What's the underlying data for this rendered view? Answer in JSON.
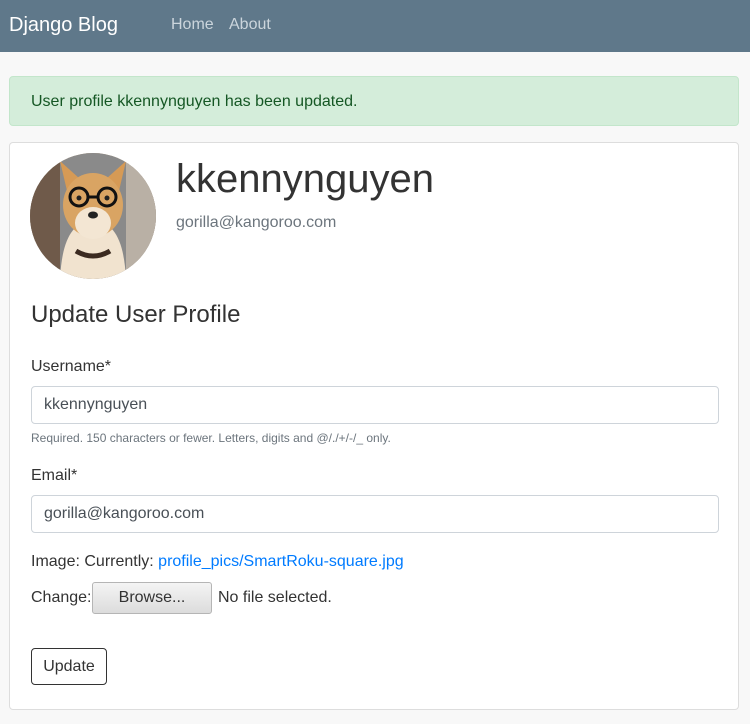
{
  "navbar": {
    "brand": "Django Blog",
    "links": [
      "Home",
      "About"
    ]
  },
  "alert": {
    "message": "User profile kkennynguyen has been updated."
  },
  "profile": {
    "username": "kkennynguyen",
    "email": "gorilla@kangoroo.com",
    "avatar_icon": "avatar-photo"
  },
  "form": {
    "title": "Update User Profile",
    "username_label": "Username*",
    "username_value": "kkennynguyen",
    "username_help": "Required. 150 characters or fewer. Letters, digits and @/./+/-/_ only.",
    "email_label": "Email*",
    "email_value": "gorilla@kangoroo.com",
    "image_label": "Image: Currently:",
    "image_current": "profile_pics/SmartRoku-square.jpg",
    "change_label": "Change:",
    "browse_label": "Browse...",
    "file_status": "No file selected.",
    "submit_label": "Update"
  },
  "colors": {
    "navbar_bg": "#5f788a",
    "alert_bg": "#d4edda",
    "alert_text": "#155724",
    "link": "#007bff"
  }
}
